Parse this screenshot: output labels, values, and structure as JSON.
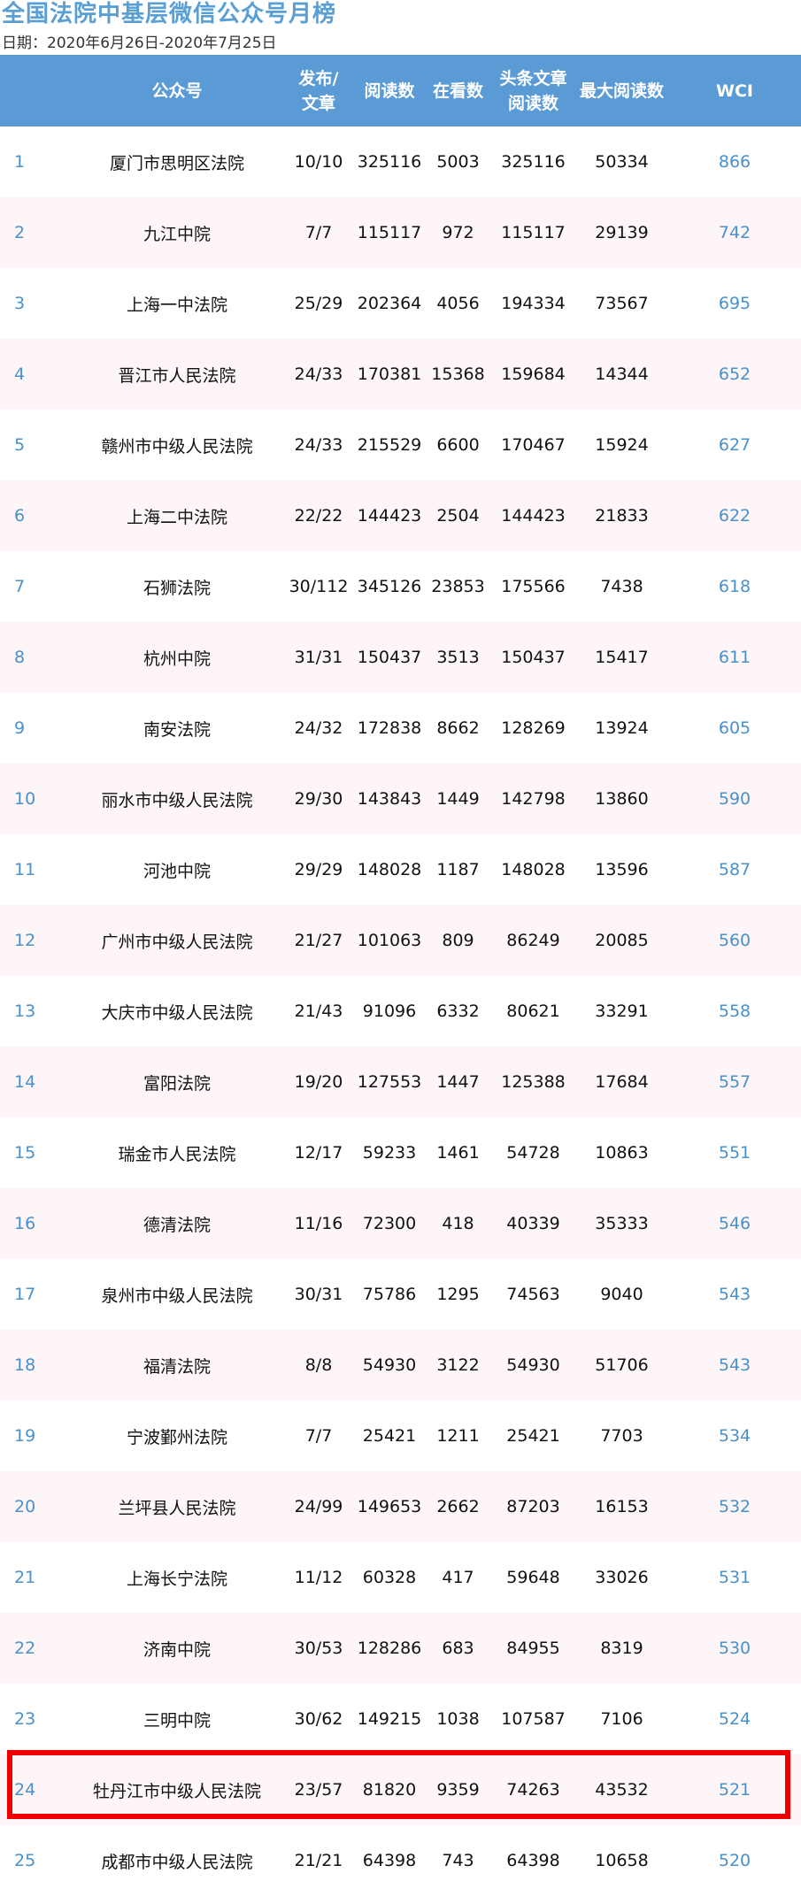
{
  "page": {
    "title": "全国法院中基层微信公众号月榜",
    "date_range": "日期：2020年6月26日-2020年7月25日"
  },
  "table": {
    "headers": [
      "",
      "公众号",
      "发布/\n文章",
      "阅读数",
      "在看数",
      "头条文章\n阅读数",
      "最大阅读数",
      "WCI"
    ],
    "rows": [
      [
        "1",
        "厦门市思明区法院",
        "10/10",
        "325116",
        "5003",
        "325116",
        "50334",
        "866"
      ],
      [
        "2",
        "九江中院",
        "7/7",
        "115117",
        "972",
        "115117",
        "29139",
        "742"
      ],
      [
        "3",
        "上海一中法院",
        "25/29",
        "202364",
        "4056",
        "194334",
        "73567",
        "695"
      ],
      [
        "4",
        "晋江市人民法院",
        "24/33",
        "170381",
        "15368",
        "159684",
        "14344",
        "652"
      ],
      [
        "5",
        "赣州市中级人民法院",
        "24/33",
        "215529",
        "6600",
        "170467",
        "15924",
        "627"
      ],
      [
        "6",
        "上海二中法院",
        "22/22",
        "144423",
        "2504",
        "144423",
        "21833",
        "622"
      ],
      [
        "7",
        "石狮法院",
        "30/112",
        "345126",
        "23853",
        "175566",
        "7438",
        "618"
      ],
      [
        "8",
        "杭州中院",
        "31/31",
        "150437",
        "3513",
        "150437",
        "15417",
        "611"
      ],
      [
        "9",
        "南安法院",
        "24/32",
        "172838",
        "8662",
        "128269",
        "13924",
        "605"
      ],
      [
        "10",
        "丽水市中级人民法院",
        "29/30",
        "143843",
        "1449",
        "142798",
        "13860",
        "590"
      ],
      [
        "11",
        "河池中院",
        "29/29",
        "148028",
        "1187",
        "148028",
        "13596",
        "587"
      ],
      [
        "12",
        "广州市中级人民法院",
        "21/27",
        "101063",
        "809",
        "86249",
        "20085",
        "560"
      ],
      [
        "13",
        "大庆市中级人民法院",
        "21/43",
        "91096",
        "6332",
        "80621",
        "33291",
        "558"
      ],
      [
        "14",
        "富阳法院",
        "19/20",
        "127553",
        "1447",
        "125388",
        "17684",
        "557"
      ],
      [
        "15",
        "瑞金市人民法院",
        "12/17",
        "59233",
        "1461",
        "54728",
        "10863",
        "551"
      ],
      [
        "16",
        "德清法院",
        "11/16",
        "72300",
        "418",
        "40339",
        "35333",
        "546"
      ],
      [
        "17",
        "泉州市中级人民法院",
        "30/31",
        "75786",
        "1295",
        "74563",
        "9040",
        "543"
      ],
      [
        "18",
        "福清法院",
        "8/8",
        "54930",
        "3122",
        "54930",
        "51706",
        "543"
      ],
      [
        "19",
        "宁波鄞州法院",
        "7/7",
        "25421",
        "1211",
        "25421",
        "7703",
        "534"
      ],
      [
        "20",
        "兰坪县人民法院",
        "24/99",
        "149653",
        "2662",
        "87203",
        "16153",
        "532"
      ],
      [
        "21",
        "上海长宁法院",
        "11/12",
        "60328",
        "417",
        "59648",
        "33026",
        "531"
      ],
      [
        "22",
        "济南中院",
        "30/53",
        "128286",
        "683",
        "84955",
        "8319",
        "530"
      ],
      [
        "23",
        "三明中院",
        "30/62",
        "149215",
        "1038",
        "107587",
        "7106",
        "524"
      ],
      [
        "24",
        "牡丹江市中级人民法院",
        "23/57",
        "81820",
        "9359",
        "74263",
        "43532",
        "521"
      ],
      [
        "25",
        "成都市中级人民法院",
        "21/21",
        "64398",
        "743",
        "64398",
        "10658",
        "520"
      ]
    ],
    "highlighted_row": "24"
  },
  "colors": {
    "header_bg": "#5b9bd5",
    "title": "#5a9fd4",
    "rank_and_wci": "#4a90c9",
    "stripe": "#fdf5f7",
    "highlight_border": "#ee0000"
  }
}
